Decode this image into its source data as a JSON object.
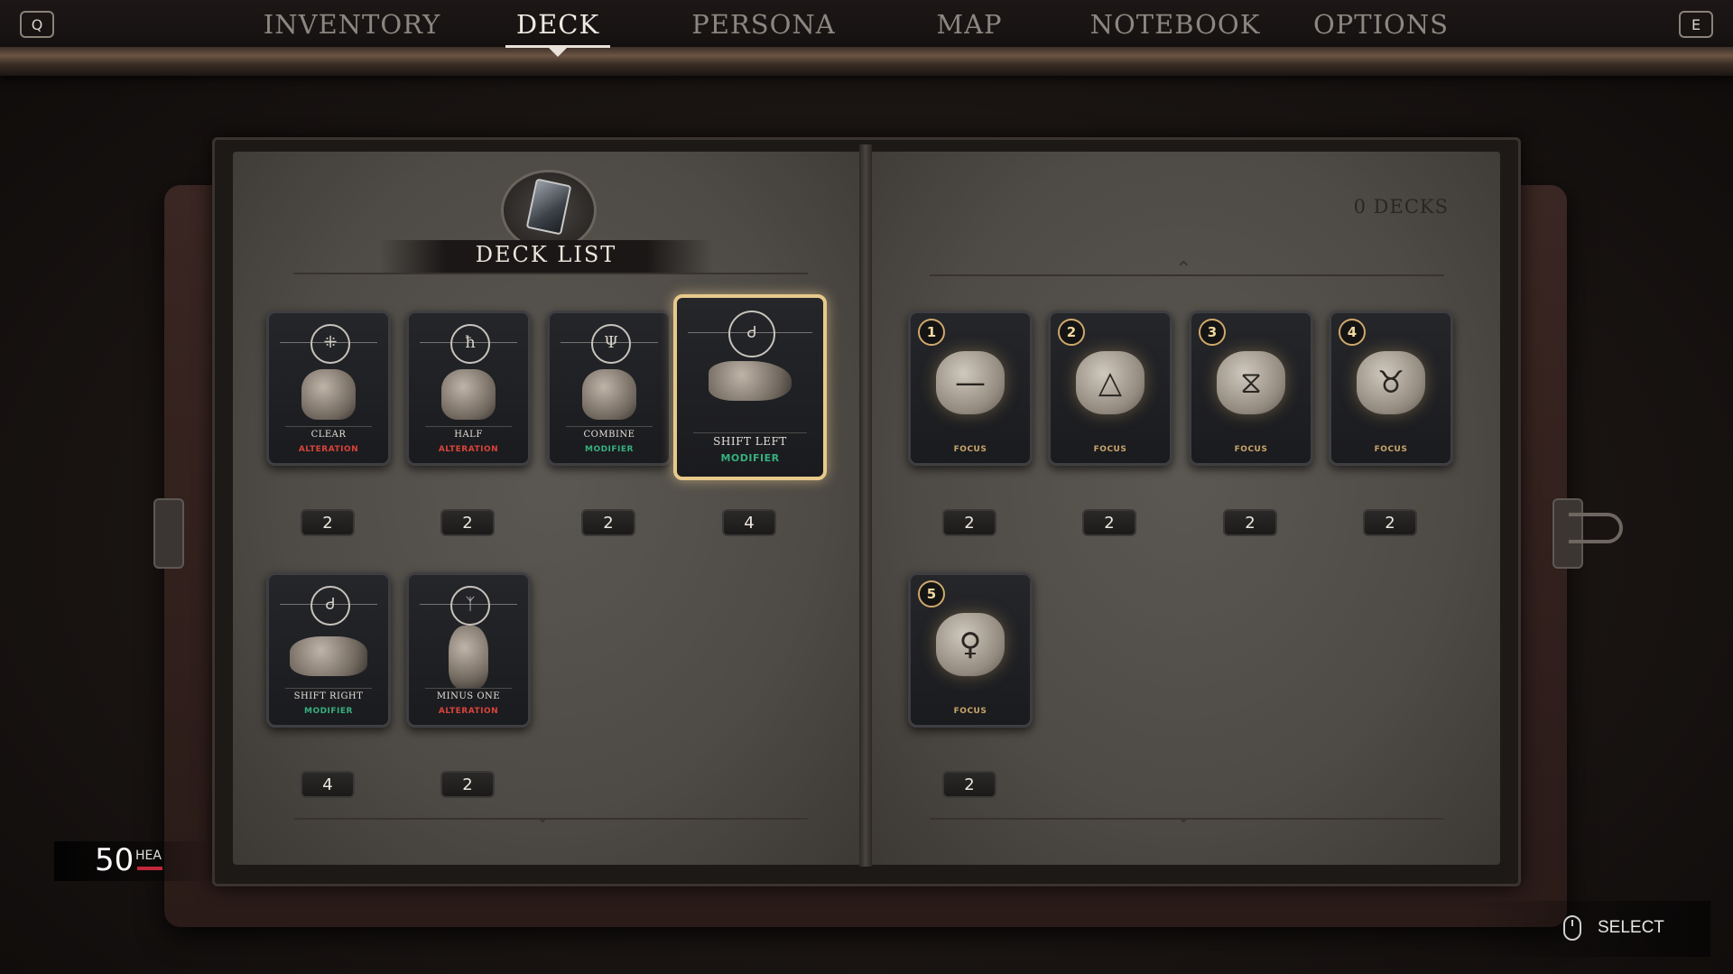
{
  "nav": {
    "left_key": "Q",
    "right_key": "E",
    "tabs": [
      "INVENTORY",
      "DECK",
      "PERSONA",
      "MAP",
      "NOTEBOOK",
      "OPTIONS"
    ],
    "active_tab": "DECK"
  },
  "left_page": {
    "title": "DECK LIST",
    "cards": [
      {
        "glyph": "⁜",
        "name": "CLEAR",
        "type": "ALTERATION",
        "count": "2"
      },
      {
        "glyph": "ħ",
        "name": "HALF",
        "type": "ALTERATION",
        "count": "2"
      },
      {
        "glyph": "Ψ",
        "name": "COMBINE",
        "type": "MODIFIER",
        "count": "2"
      },
      {
        "glyph": "Ꮷ",
        "name": "SHIFT LEFT",
        "type": "MODIFIER",
        "count": "4",
        "selected": true
      },
      {
        "glyph": "Ꮷ",
        "name": "SHIFT RIGHT",
        "type": "MODIFIER",
        "count": "4"
      },
      {
        "glyph": "ᛉ",
        "name": "MINUS ONE",
        "type": "ALTERATION",
        "count": "2"
      }
    ]
  },
  "right_page": {
    "decks_label": "0 DECKS",
    "cards": [
      {
        "number": "1",
        "rune": "—",
        "type": "FOCUS",
        "count": "2"
      },
      {
        "number": "2",
        "rune": "△",
        "type": "FOCUS",
        "count": "2"
      },
      {
        "number": "3",
        "rune": "⧖",
        "type": "FOCUS",
        "count": "2"
      },
      {
        "number": "4",
        "rune": "♉",
        "type": "FOCUS",
        "count": "2"
      },
      {
        "number": "5",
        "rune": "♀",
        "type": "FOCUS",
        "count": "2"
      }
    ]
  },
  "hud": {
    "health_value": "50",
    "health_label": "HEALTH",
    "select_label": "SELECT",
    "select_icon": "mouse-icon"
  },
  "colors": {
    "alteration": "#d9433a",
    "modifier": "#36b07e",
    "focus": "#c9a56a",
    "selected_border": "#e7c98c"
  }
}
